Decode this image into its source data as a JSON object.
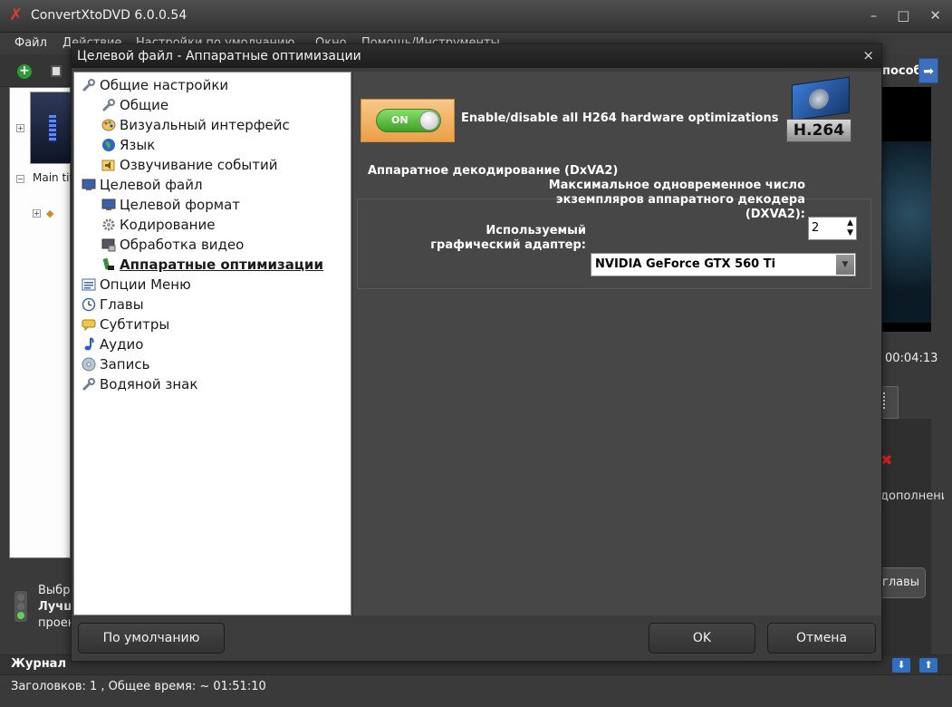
{
  "app": {
    "title": "ConvertXtoDVD 6.0.0.54",
    "menu": [
      "Файл",
      "Действие",
      "Настройки по умолчанию",
      "Окно",
      "Помощь/Инструменты"
    ]
  },
  "left_panel": {
    "tree_label": "Main tit"
  },
  "status_area": {
    "line1": "Выбр",
    "line2": "Лучш",
    "line3": "проек"
  },
  "journal": {
    "label": "Журнал"
  },
  "statusbar": {
    "text": "Заголовков: 1 , Общее время: ~ 01:51:10"
  },
  "right_panel": {
    "header": "пособ",
    "time": "00:04:13",
    "additional": "дополнени",
    "chapters_button": "главы"
  },
  "dialog": {
    "title": "Целевой файл - Аппаратные оптимизации",
    "close": "×",
    "tree": [
      {
        "label": "Общие настройки",
        "icon": "wrench-icon",
        "level": 0
      },
      {
        "label": "Общие",
        "icon": "wrench-icon",
        "level": 1
      },
      {
        "label": "Визуальный интерфейс",
        "icon": "palette-icon",
        "level": 1
      },
      {
        "label": "Язык",
        "icon": "globe-icon",
        "level": 1
      },
      {
        "label": "Озвучивание событий",
        "icon": "sound-icon",
        "level": 1
      },
      {
        "label": "Целевой файл",
        "icon": "monitor-icon",
        "level": 0
      },
      {
        "label": "Целевой формат",
        "icon": "monitor-icon",
        "level": 1
      },
      {
        "label": "Кодирование",
        "icon": "gear-icon",
        "level": 1
      },
      {
        "label": "Обработка видео",
        "icon": "video-icon",
        "level": 1
      },
      {
        "label": "Аппаратные оптимизации",
        "icon": "hardware-icon",
        "level": 1,
        "selected": true
      },
      {
        "label": "Опции Меню",
        "icon": "menu-icon",
        "level": 0
      },
      {
        "label": "Главы",
        "icon": "clock-icon",
        "level": 0
      },
      {
        "label": "Субтитры",
        "icon": "subtitle-icon",
        "level": 0
      },
      {
        "label": "Аудио",
        "icon": "music-note-icon",
        "level": 0
      },
      {
        "label": "Запись",
        "icon": "disc-icon",
        "level": 0
      },
      {
        "label": "Водяной знак",
        "icon": "wrench-icon",
        "level": 0
      }
    ],
    "toggle_on": "ON",
    "enable_label": "Enable/disable all H264 hardware optimizations",
    "h264_badge": "H.264",
    "group_title": "Аппаратное декодирование (DxVA2)",
    "max_decoders_label_1": "Максимальное одновременное число",
    "max_decoders_label_2": "экземпляров аппаратного декодера",
    "max_decoders_label_3": "(DXVA2):",
    "max_decoders_value": "2",
    "adapter_label_1": "Используемый",
    "adapter_label_2": "графический адаптер:",
    "adapter_value": "NVIDIA GeForce GTX 560 Ti",
    "buttons": {
      "default": "По умолчанию",
      "ok": "OK",
      "cancel": "Отмена"
    }
  }
}
